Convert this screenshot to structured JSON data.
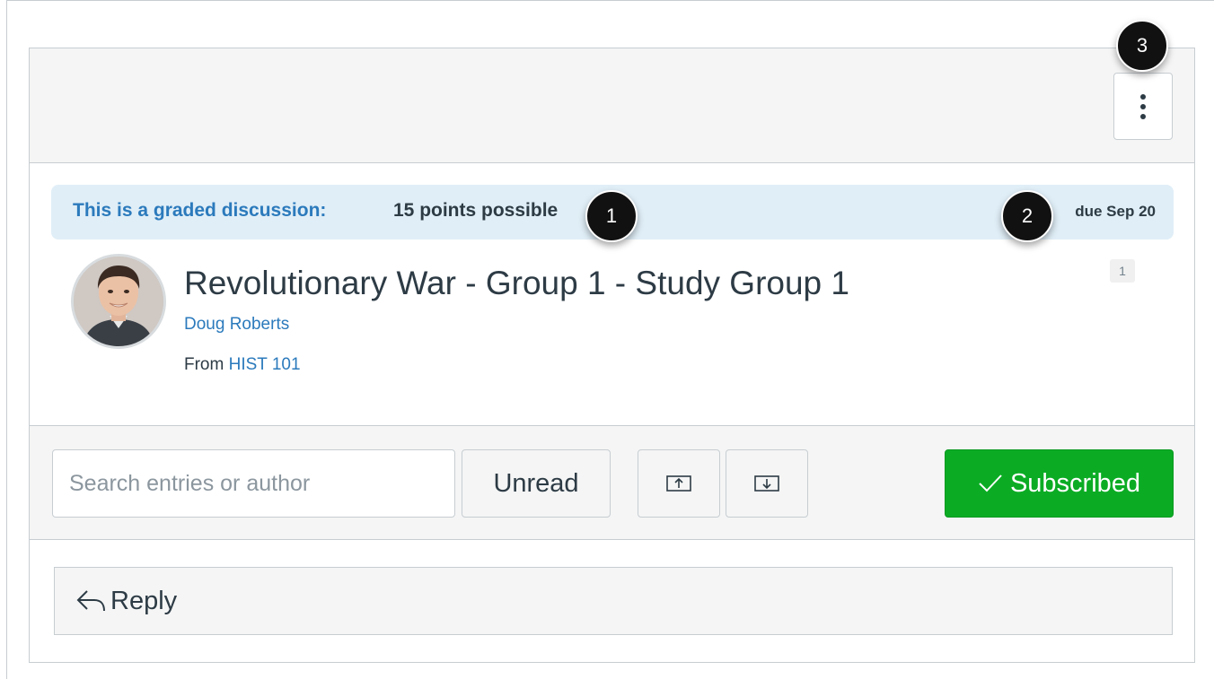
{
  "header": {
    "options_icon": "vertical-ellipsis-icon"
  },
  "callouts": [
    "1",
    "2",
    "3"
  ],
  "graded": {
    "label": "This is a graded discussion:",
    "points": "15 points possible",
    "due": "due Sep 20"
  },
  "topic": {
    "title": "Revolutionary War - Group 1 - Study Group 1",
    "author": "Doug Roberts",
    "from_prefix": "From",
    "course": "HIST 101",
    "unread_count": "1"
  },
  "toolbar": {
    "search_placeholder": "Search entries or author",
    "unread_label": "Unread",
    "collapse_icon": "collapse-all-icon",
    "expand_icon": "expand-all-icon",
    "subscribed_label": "Subscribed",
    "subscribed_icon": "checkmark-icon"
  },
  "reply": {
    "label": "Reply",
    "icon": "reply-arrow-icon"
  },
  "colors": {
    "link": "#2b7abc",
    "banner_bg": "#e0eef7",
    "subscribed_green": "#0bac24",
    "callout_black": "#111111"
  }
}
